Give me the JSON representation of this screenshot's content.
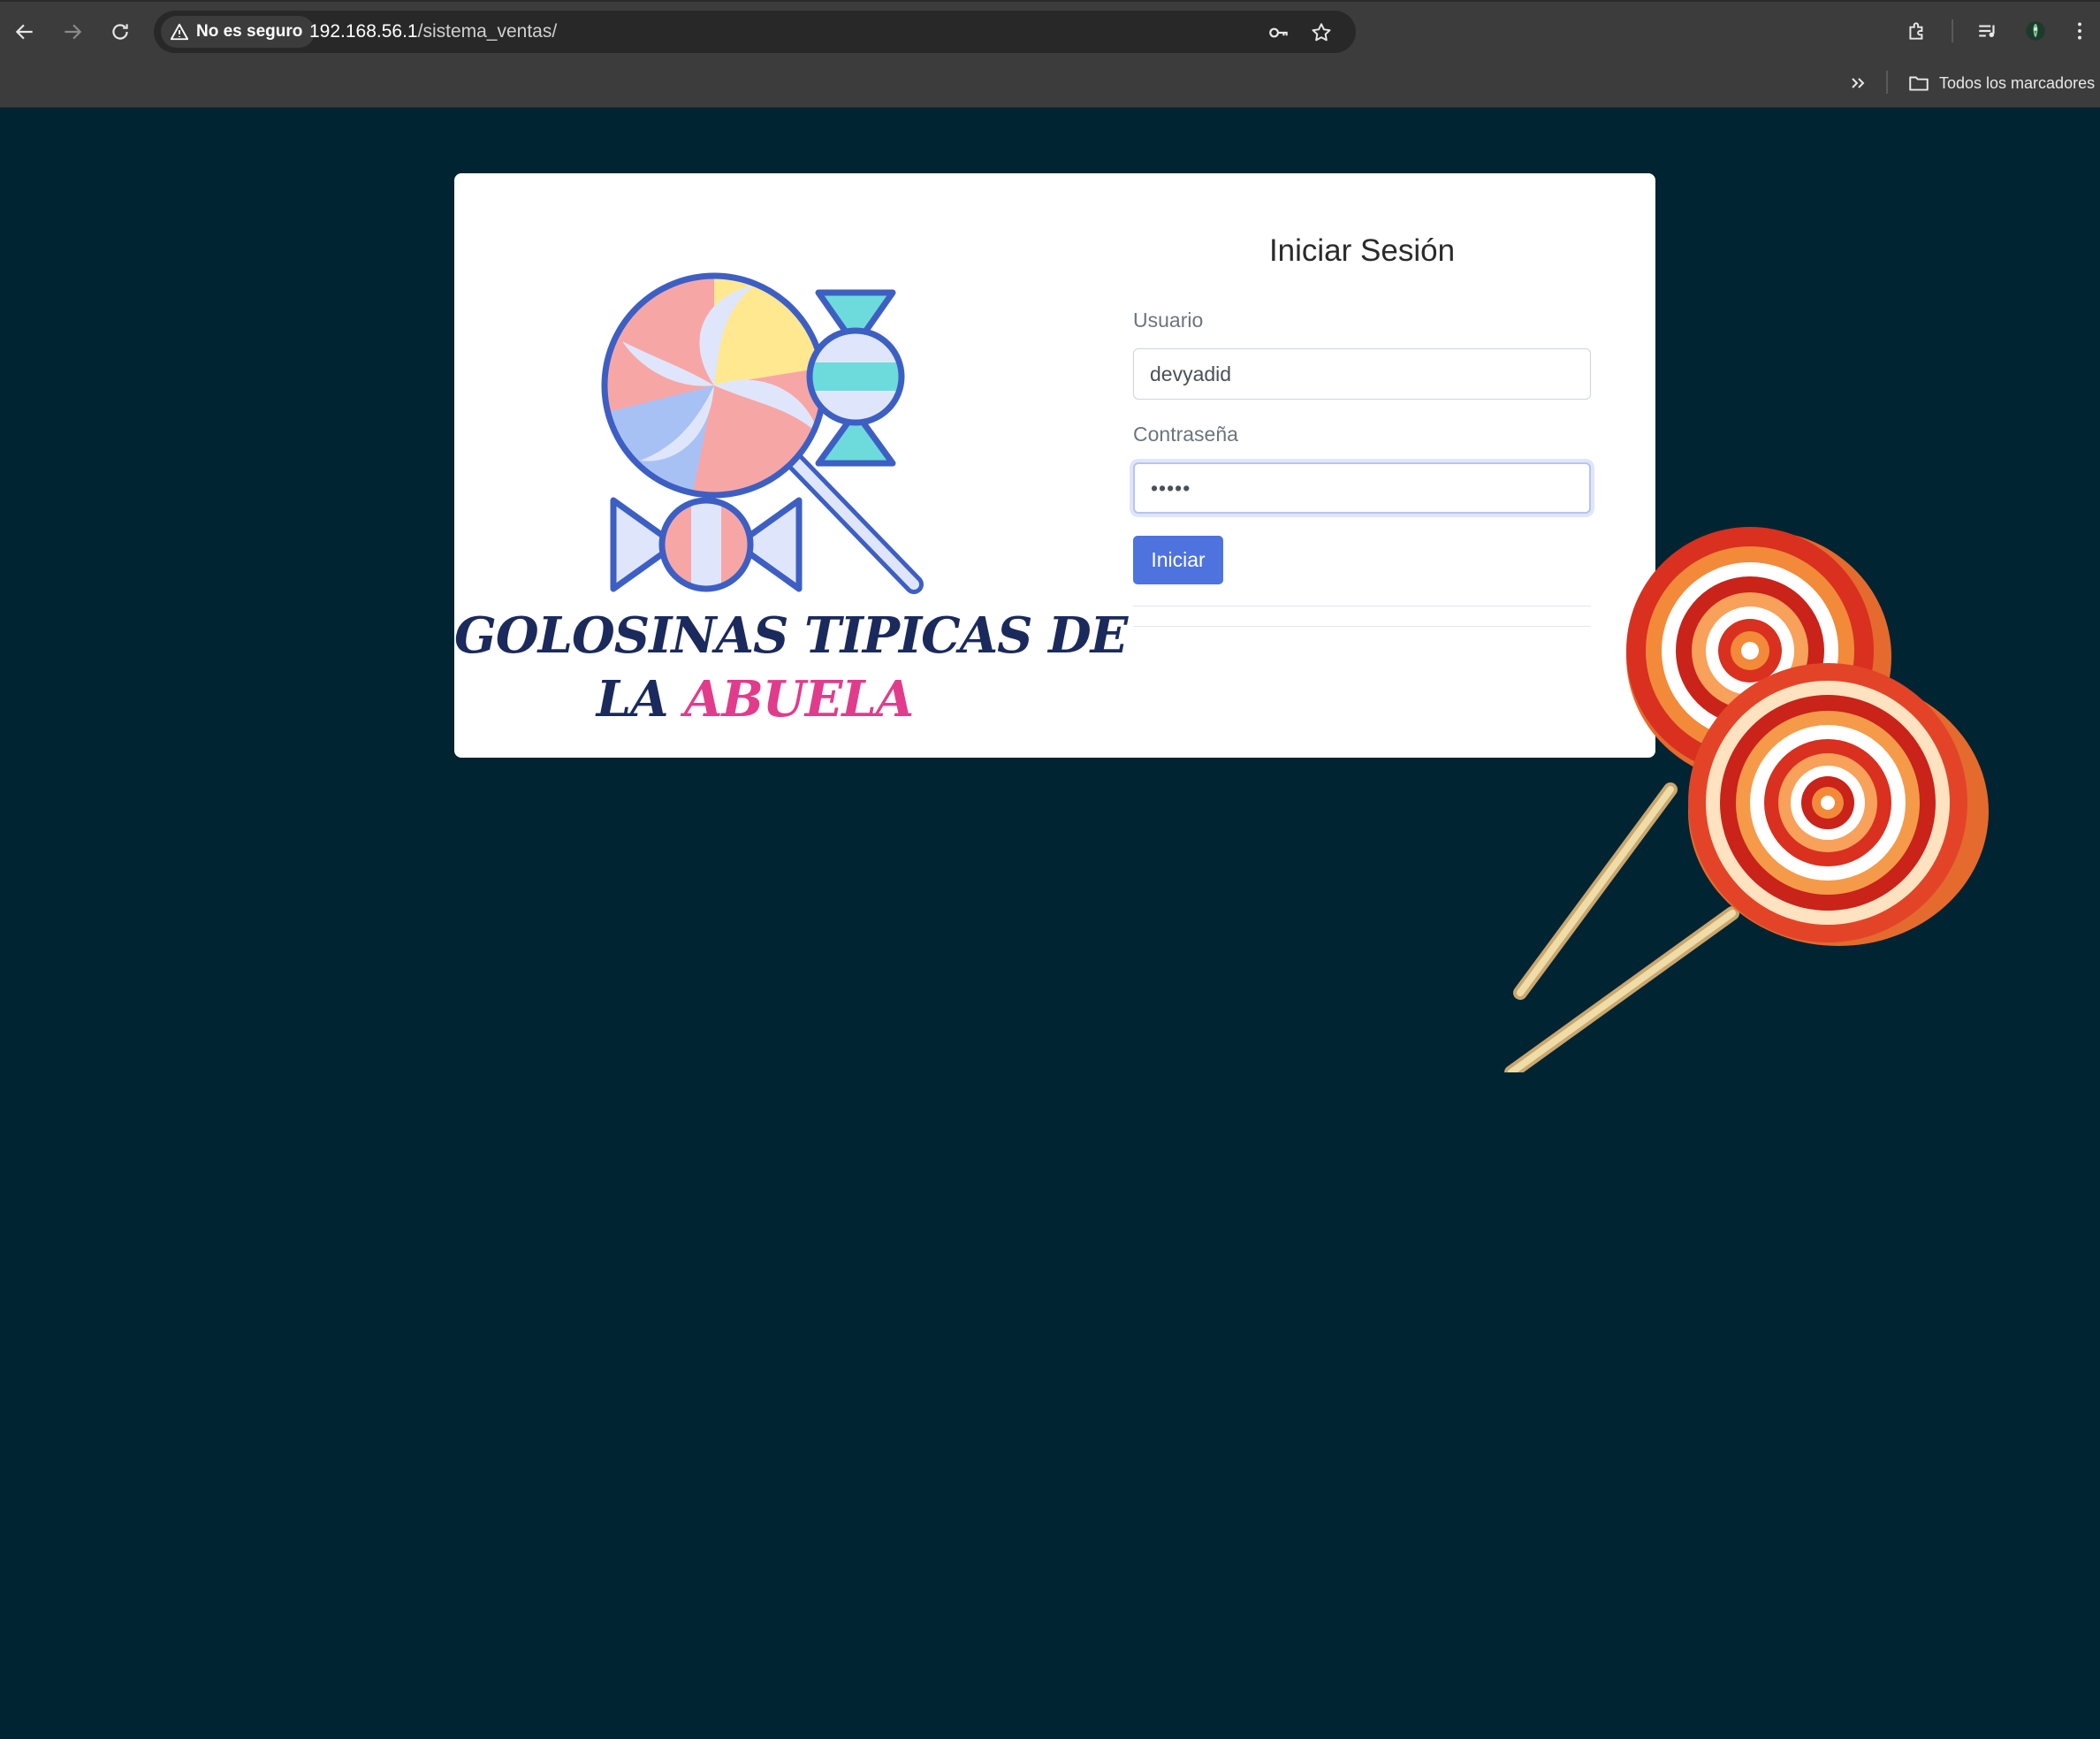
{
  "browser": {
    "security_label": "No es seguro",
    "url_host": "192.168.56.1",
    "url_path": "/sistema_ventas/",
    "bookmarks_folder_label": "Todos los marcadores"
  },
  "brand": {
    "line1": "GOLOSINAS TIPICAS DE",
    "line2_part1": "LA",
    "line2_part2": "ABUELA",
    "colors": {
      "navy": "#1b2a5c",
      "pink": "#e13c8c"
    }
  },
  "login": {
    "title": "Iniciar Sesión",
    "username_label": "Usuario",
    "username_value": "devyadid",
    "password_label": "Contraseña",
    "password_value": "•••••",
    "submit_label": "Iniciar"
  },
  "theme": {
    "page_background": "#002431",
    "accent": "#4e73df"
  }
}
